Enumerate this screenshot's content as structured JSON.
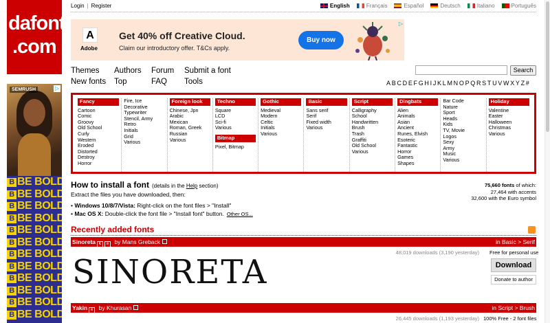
{
  "logo": {
    "line1": "dafont",
    "line2": ".com"
  },
  "side_ad": {
    "brand": "SEMRUSH",
    "repeat_text": "BE BOLD",
    "repeat_mark": "B",
    "rows": 12
  },
  "auth": {
    "login": "Login",
    "separator": "|",
    "register": "Register"
  },
  "languages": [
    {
      "label": "English",
      "active": true,
      "flag": "uk-flag-icon"
    },
    {
      "label": "Français",
      "active": false,
      "flag": "france-flag-icon"
    },
    {
      "label": "Español",
      "active": false,
      "flag": "spain-flag-icon"
    },
    {
      "label": "Deutsch",
      "active": false,
      "flag": "germany-flag-icon"
    },
    {
      "label": "Italiano",
      "active": false,
      "flag": "italy-flag-icon"
    },
    {
      "label": "Português",
      "active": false,
      "flag": "portugal-flag-icon"
    }
  ],
  "banner": {
    "brand": "Adobe",
    "headline": "Get 40% off Creative Cloud.",
    "subline": "Claim our introductory offer. T&Cs apply.",
    "cta": "Buy now",
    "accent": "#1473e6"
  },
  "nav": {
    "themes": "Themes",
    "authors": "Authors",
    "forum": "Forum",
    "submit": "Submit a font",
    "new_fonts": "New fonts",
    "top": "Top",
    "faq": "FAQ",
    "tools": "Tools"
  },
  "search": {
    "value": "",
    "button": "Search"
  },
  "alphabet": [
    "A",
    "B",
    "C",
    "D",
    "E",
    "F",
    "G",
    "H",
    "I",
    "J",
    "K",
    "L",
    "M",
    "N",
    "O",
    "P",
    "Q",
    "R",
    "S",
    "T",
    "U",
    "V",
    "W",
    "X",
    "Y",
    "Z",
    "#"
  ],
  "categories": [
    {
      "groups": [
        {
          "title": "Fancy",
          "items": [
            "Cartoon",
            "Comic",
            "Groovy",
            "Old School",
            "Curly",
            "Western",
            "Eroded",
            "Distorted",
            "Destroy",
            "Horror"
          ]
        }
      ]
    },
    {
      "groups": [
        {
          "title": "",
          "items": [
            "Fire, Ice",
            "Decorative",
            "Typewriter",
            "Stencil, Army",
            "Retro",
            "Initials",
            "Grid",
            "Various"
          ]
        }
      ]
    },
    {
      "groups": [
        {
          "title": "Foreign look",
          "items": [
            "Chinese, Jpn",
            "Arabic",
            "Mexican",
            "Roman, Greek",
            "Russian",
            "Various"
          ]
        }
      ]
    },
    {
      "groups": [
        {
          "title": "Techno",
          "items": [
            "Square",
            "LCD",
            "Sci-fi",
            "Various"
          ]
        },
        {
          "title": "Bitmap",
          "items": [
            "Pixel, Bitmap"
          ]
        }
      ]
    },
    {
      "groups": [
        {
          "title": "Gothic",
          "items": [
            "Medieval",
            "Modern",
            "Celtic",
            "Initials",
            "Various"
          ]
        }
      ]
    },
    {
      "groups": [
        {
          "title": "Basic",
          "items": [
            "Sans serif",
            "Serif",
            "Fixed width",
            "Various"
          ]
        }
      ]
    },
    {
      "groups": [
        {
          "title": "Script",
          "items": [
            "Calligraphy",
            "School",
            "Handwritten",
            "Brush",
            "Trash",
            "Graffiti",
            "Old School",
            "Various"
          ]
        }
      ]
    },
    {
      "groups": [
        {
          "title": "Dingbats",
          "items": [
            "Alien",
            "Animals",
            "Asian",
            "Ancient",
            "Runes, Elvish",
            "Esoteric",
            "Fantastic",
            "Horror",
            "Games",
            "Shapes"
          ]
        }
      ]
    },
    {
      "groups": [
        {
          "title": "",
          "items": [
            "Bar Code",
            "Nature",
            "Sport",
            "Heads",
            "Kids",
            "TV, Movie",
            "Logos",
            "Sexy",
            "Army",
            "Music",
            "Various"
          ]
        }
      ]
    },
    {
      "groups": [
        {
          "title": "Holiday",
          "items": [
            "Valentine",
            "Easter",
            "Halloween",
            "Christmas",
            "Various"
          ]
        }
      ]
    }
  ],
  "install": {
    "title": "How to install a font",
    "note_pre": "(details in the ",
    "note_link": "Help",
    "note_post": " section)",
    "sub": "Extract the files you have downloaded, then:",
    "win_label": "Windows 10/8/7/Vista:",
    "win_text": " Right-click on the font files > \"Install\"",
    "mac_label": "Mac OS X:",
    "mac_text": " Double-click the font file > \"Install font\" button.",
    "other": "Other OS..."
  },
  "stats": {
    "total": "75,660 fonts",
    "total_suffix": " of which:",
    "accents": "27,464 with accents",
    "euro": "32,600 with the Euro symbol"
  },
  "recent": {
    "title": "Recently added fonts"
  },
  "fonts": [
    {
      "name": "Sinoreta",
      "author_prefix": "by",
      "author": "Mans Greback",
      "category": "in Basic > Serif",
      "downloads": "48,019 downloads (3,190 yesterday)",
      "license": "Free for personal use",
      "preview": "SINORETA",
      "download_label": "Download",
      "donate_label": "Donate to author"
    },
    {
      "name": "Yakin",
      "author_prefix": "by",
      "author": "Khurasan",
      "category": "in Script > Brush",
      "downloads": "26,445 downloads (1,193 yesterday)",
      "license": "100% Free - 2 font files"
    }
  ],
  "colors": {
    "brand_red": "#cc0000",
    "ad_yellow": "#f5d300",
    "ad_blue": "#2d2d8f"
  }
}
